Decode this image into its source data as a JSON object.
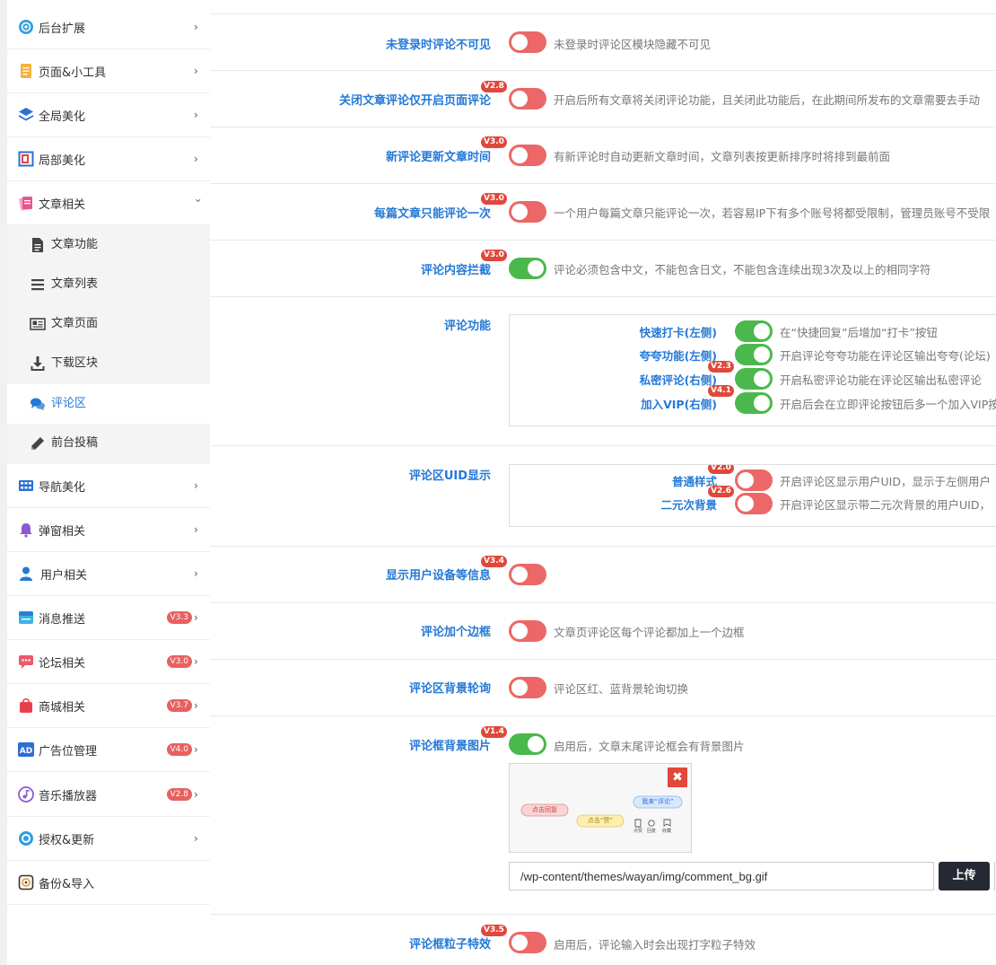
{
  "sidebar": {
    "items": [
      {
        "label": "后台扩展",
        "icon": "gear-icon"
      },
      {
        "label": "页面&小工具",
        "icon": "document-icon"
      },
      {
        "label": "全局美化",
        "icon": "layers-icon"
      },
      {
        "label": "局部美化",
        "icon": "frame-icon"
      },
      {
        "label": "文章相关",
        "icon": "article-icon"
      },
      {
        "label": "导航美化",
        "icon": "grid-icon"
      },
      {
        "label": "弹窗相关",
        "icon": "bell-icon"
      },
      {
        "label": "用户相关",
        "icon": "user-icon"
      },
      {
        "label": "消息推送",
        "icon": "message-icon",
        "badge": "V3.3"
      },
      {
        "label": "论坛相关",
        "icon": "chat-icon",
        "badge": "V3.0"
      },
      {
        "label": "商城相关",
        "icon": "shop-bag-icon",
        "badge": "V3.7"
      },
      {
        "label": "广告位管理",
        "icon": "ad-icon",
        "badge": "V4.0"
      },
      {
        "label": "音乐播放器",
        "icon": "music-icon",
        "badge": "V2.8"
      },
      {
        "label": "授权&更新",
        "icon": "shield-icon"
      },
      {
        "label": "备份&导入",
        "icon": "backup-icon"
      }
    ],
    "submenu": [
      {
        "label": "文章功能",
        "icon": "file-icon"
      },
      {
        "label": "文章列表",
        "icon": "list-icon"
      },
      {
        "label": "文章页面",
        "icon": "page-icon"
      },
      {
        "label": "下载区块",
        "icon": "download-icon"
      },
      {
        "label": "评论区",
        "icon": "comments-icon",
        "active": true
      },
      {
        "label": "前台投稿",
        "icon": "pencil-icon"
      }
    ]
  },
  "settings": [
    {
      "label": "未登录时评论不可见",
      "on": false,
      "desc": "未登录时评论区模块隐藏不可见"
    },
    {
      "label": "关闭文章评论仅开启页面评论",
      "badge": "V2.8",
      "on": false,
      "desc": "开启后所有文章将关闭评论功能，且关闭此功能后，在此期间所发布的文章需要去手动"
    },
    {
      "label": "新评论更新文章时间",
      "badge": "V3.0",
      "on": false,
      "desc": "有新评论时自动更新文章时间，文章列表按更新排序时将排到最前面"
    },
    {
      "label": "每篇文章只能评论一次",
      "badge": "V3.0",
      "on": false,
      "desc": "一个用户每篇文章只能评论一次，若容易IP下有多个账号将都受限制，管理员账号不受限"
    },
    {
      "label": "评论内容拦截",
      "badge": "V3.0",
      "on": true,
      "desc": "评论必须包含中文，不能包含日文，不能包含连续出现3次及以上的相同字符"
    },
    {
      "label": "评论功能",
      "subs": [
        {
          "label": "快速打卡(左侧)",
          "on": true,
          "desc": "在“快捷回复”后增加“打卡”按钮"
        },
        {
          "label": "夸夸功能(左侧)",
          "on": true,
          "desc": "开启评论夸夸功能在评论区输出夸夸(论坛)"
        },
        {
          "label": "私密评论(右侧)",
          "badge": "V2.3",
          "on": true,
          "desc": "开启私密评论功能在评论区输出私密评论"
        },
        {
          "label": "加入VIP(右侧)",
          "badge": "V4.1",
          "on": true,
          "desc": "开启后会在立即评论按钮后多一个加入VIP按"
        }
      ]
    },
    {
      "label": "评论区UID显示",
      "subs": [
        {
          "label": "普通样式",
          "badge": "V2.0",
          "on": false,
          "desc": "开启评论区显示用户UID，显示于左侧用户"
        },
        {
          "label": "二元次背景",
          "badge": "V2.6",
          "on": false,
          "desc": "开启评论区显示带二元次背景的用户UID，"
        }
      ]
    },
    {
      "label": "显示用户设备等信息",
      "badge": "V3.4",
      "on": false,
      "desc": ""
    },
    {
      "label": "评论加个边框",
      "on": false,
      "desc": "文章页评论区每个评论都加上一个边框"
    },
    {
      "label": "评论区背景轮询",
      "on": false,
      "desc": "评论区红、蓝背景轮询切换"
    },
    {
      "label": "评论框背景图片",
      "badge": "V1.4",
      "on": true,
      "desc": "启用后，文章末尾评论框会有背景图片",
      "image_path": "/wp-content/themes/wayan/img/comment_bg.gif",
      "upload_label": "上传"
    },
    {
      "label": "评论框粒子特效",
      "badge": "V3.5",
      "on": false,
      "desc": "启用后，评论输入时会出现打字粒子特效"
    }
  ],
  "preview": {
    "bubble_left": "点击回复",
    "bubble_mid": "点击“赞”",
    "bubble_right": "我来“评论”",
    "icon_labels": [
      "点赞",
      "回复",
      "收藏"
    ],
    "close_label": "✖"
  },
  "colors": {
    "accent": "#2479d6",
    "toggle_on": "#4bb84d",
    "toggle_off": "#ec6767",
    "badge": "#e0483b"
  }
}
